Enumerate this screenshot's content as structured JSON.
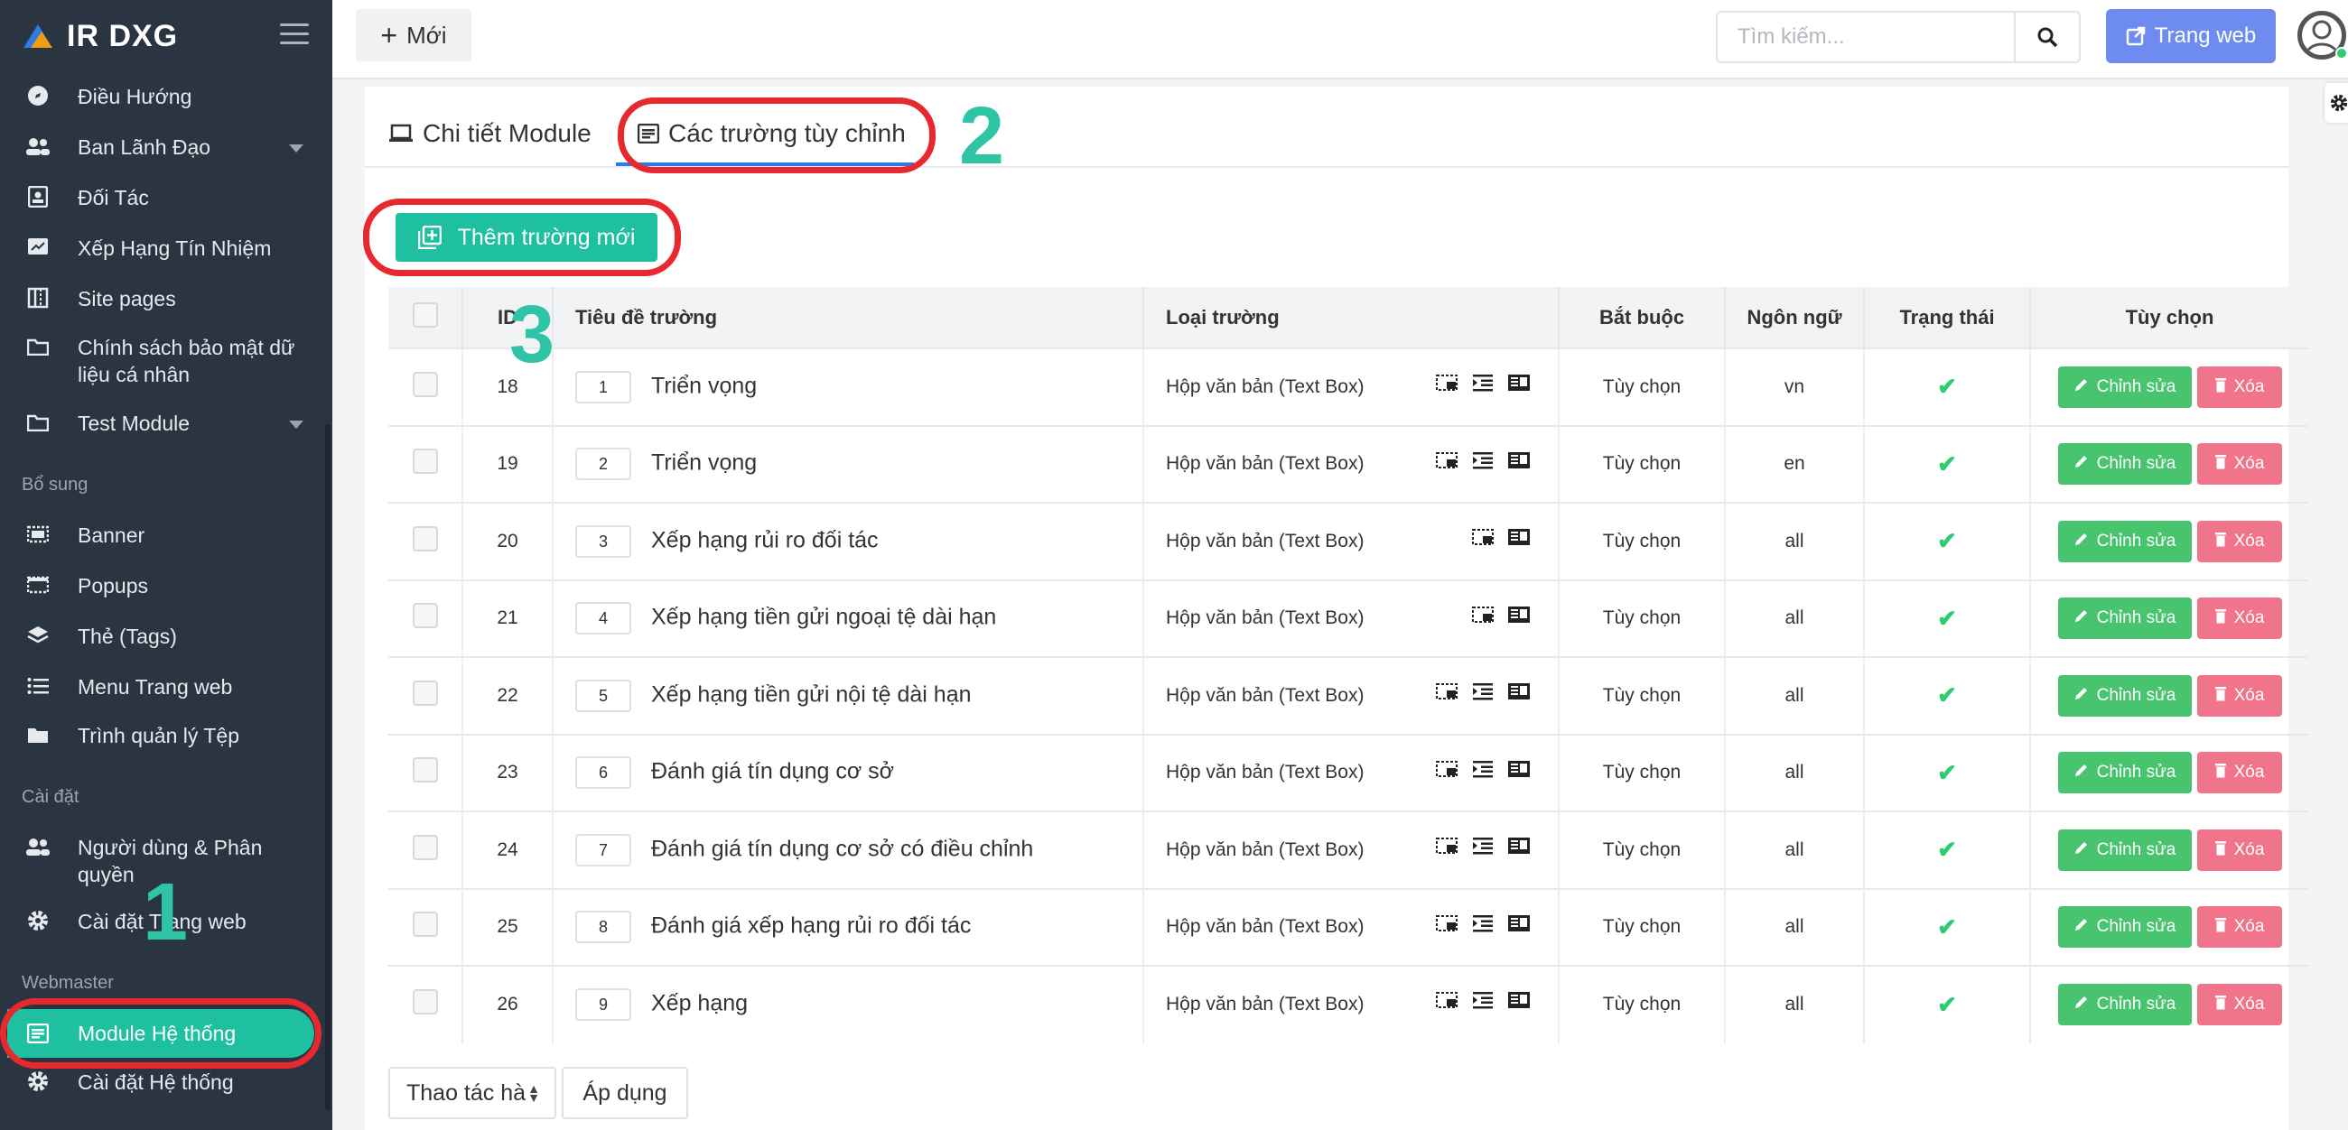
{
  "app": {
    "title": "IR DXG"
  },
  "sidebar": {
    "items": [
      {
        "label": "Điều Hướng",
        "icon": "compass-icon"
      },
      {
        "label": "Ban Lãnh Đạo",
        "icon": "users-icon",
        "has_caret": true
      },
      {
        "label": "Đối Tác",
        "icon": "id-card-icon"
      },
      {
        "label": "Xếp Hạng Tín Nhiệm",
        "icon": "rating-icon"
      },
      {
        "label": "Site pages",
        "icon": "pages-icon"
      },
      {
        "label": "Chính sách bảo mật dữ liệu cá nhân",
        "icon": "folder-icon"
      },
      {
        "label": "Test Module",
        "icon": "folder-icon",
        "has_caret": true
      }
    ],
    "section_extra": "Bổ sung",
    "extra_items": [
      {
        "label": "Banner",
        "icon": "banner-icon"
      },
      {
        "label": "Popups",
        "icon": "popup-icon"
      },
      {
        "label": "Thẻ (Tags)",
        "icon": "layers-icon"
      },
      {
        "label": "Menu Trang web",
        "icon": "list-icon"
      },
      {
        "label": "Trình quản lý Tệp",
        "icon": "folder-icon"
      }
    ],
    "section_settings": "Cài đặt",
    "settings_items": [
      {
        "label": "Người dùng & Phân quyền",
        "icon": "users-icon"
      },
      {
        "label": "Cài đặt Trang web",
        "icon": "gear-icon"
      }
    ],
    "section_webmaster": "Webmaster",
    "webmaster_items": [
      {
        "label": "Module Hệ thống",
        "icon": "module-icon",
        "active": true
      },
      {
        "label": "Cài đặt Hệ thống",
        "icon": "gear-icon"
      }
    ]
  },
  "topbar": {
    "new_label": "Mới",
    "search_placeholder": "Tìm kiếm...",
    "website_label": "Trang web"
  },
  "tabs": [
    {
      "label": "Chi tiết Module",
      "icon": "laptop-icon"
    },
    {
      "label": "Các trường tùy chỉnh",
      "icon": "form-icon",
      "active": true
    }
  ],
  "add_field_label": "Thêm trường mới",
  "table": {
    "headers": [
      "ID",
      "Tiêu đề trường",
      "Loại trường",
      "Bắt buộc",
      "Ngôn ngữ",
      "Trạng thái",
      "Tùy chọn"
    ],
    "rows": [
      {
        "id": "18",
        "order": "1",
        "title": "Triển vọng",
        "type": "Hộp văn bản (Text Box)",
        "required": "Tùy chọn",
        "lang": "vn",
        "icons": 3
      },
      {
        "id": "19",
        "order": "2",
        "title": "Triển vọng",
        "type": "Hộp văn bản (Text Box)",
        "required": "Tùy chọn",
        "lang": "en",
        "icons": 3
      },
      {
        "id": "20",
        "order": "3",
        "title": "Xếp hạng rủi ro đối tác",
        "type": "Hộp văn bản (Text Box)",
        "required": "Tùy chọn",
        "lang": "all",
        "icons": 2
      },
      {
        "id": "21",
        "order": "4",
        "title": "Xếp hạng tiền gửi ngoại tệ dài hạn",
        "type": "Hộp văn bản (Text Box)",
        "required": "Tùy chọn",
        "lang": "all",
        "icons": 2
      },
      {
        "id": "22",
        "order": "5",
        "title": "Xếp hạng tiền gửi nội tệ dài hạn",
        "type": "Hộp văn bản (Text Box)",
        "required": "Tùy chọn",
        "lang": "all",
        "icons": 3
      },
      {
        "id": "23",
        "order": "6",
        "title": "Đánh giá tín dụng cơ sở",
        "type": "Hộp văn bản (Text Box)",
        "required": "Tùy chọn",
        "lang": "all",
        "icons": 3
      },
      {
        "id": "24",
        "order": "7",
        "title": "Đánh giá tín dụng cơ sở có điều chỉnh",
        "type": "Hộp văn bản (Text Box)",
        "required": "Tùy chọn",
        "lang": "all",
        "icons": 3
      },
      {
        "id": "25",
        "order": "8",
        "title": "Đánh giá xếp hạng rủi ro đối tác",
        "type": "Hộp văn bản (Text Box)",
        "required": "Tùy chọn",
        "lang": "all",
        "icons": 3
      },
      {
        "id": "26",
        "order": "9",
        "title": "Xếp hạng",
        "type": "Hộp văn bản (Text Box)",
        "required": "Tùy chọn",
        "lang": "all",
        "icons": 3
      }
    ],
    "edit_label": "Chỉnh sửa",
    "delete_label": "Xóa"
  },
  "bulk_action_label": "Thao tác hà",
  "apply_label": "Áp dụng",
  "annotations": {
    "n1": "1",
    "n2": "2",
    "n3": "3"
  },
  "colors": {
    "accent": "#1fc0a0",
    "sidebar": "#2b3542",
    "primary": "#6e8bf0",
    "edit": "#48c46e",
    "delete": "#f0758b",
    "annotation": "#e8282f"
  }
}
